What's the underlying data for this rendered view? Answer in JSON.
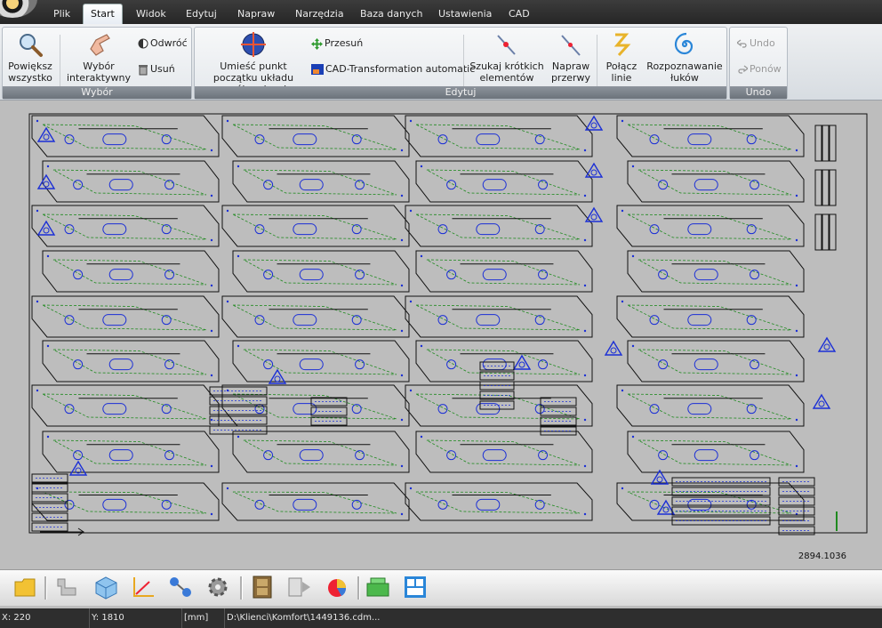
{
  "tabs": [
    "Plik",
    "Start",
    "Widok",
    "Edytuj",
    "Napraw",
    "Narzędzia",
    "Baza danych",
    "Ustawienia",
    "CAD"
  ],
  "active_tab": "Start",
  "ribbon": {
    "wybor": {
      "label": "Wybór",
      "zoom_all": "Powiększ wszystko",
      "interactive": "Wybór interaktywny",
      "invert": "Odwróć",
      "delete": "Usuń"
    },
    "edytuj": {
      "label": "Edytuj",
      "origin": "Umieść punkt początku układu współrzędnych",
      "move": "Przesuń",
      "cad_transform": "CAD-Transformation automatic",
      "find_short": "Szukaj krótkich elementów",
      "fix_gaps": "Napraw przerwy",
      "join_lines": "Połącz linie",
      "arc_recog": "Rozpoznawanie łuków"
    },
    "undo": {
      "label": "Undo",
      "undo": "Undo",
      "redo": "Ponów"
    }
  },
  "canvas": {
    "dimension_readout": "2894.1036"
  },
  "status": {
    "x": "X: 220",
    "y": "Y: 1810",
    "unit": "[mm]",
    "path": "D:\\Klienci\\Komfort\\1449136.cdm..."
  },
  "colors": {
    "outline": "#111111",
    "holes": "#1b2fd6",
    "path": "#1f8a1f"
  }
}
